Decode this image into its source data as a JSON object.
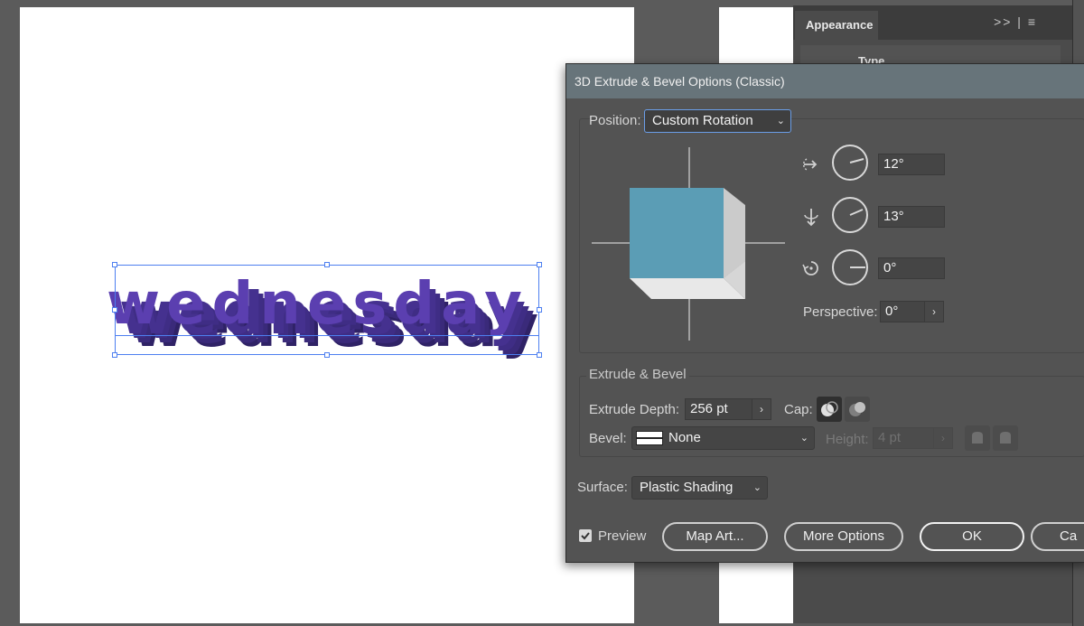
{
  "canvas": {
    "artwork_text": "wednesday",
    "text_color": "#5b3fb0",
    "extrude_color": "#3f2d85"
  },
  "appearance_panel": {
    "tab_label": "Appearance",
    "menu_icons": ">> | ≡",
    "type_row_label": "Type"
  },
  "dialog": {
    "title": "3D Extrude & Bevel Options (Classic)",
    "position": {
      "label": "Position:",
      "value": "Custom Rotation"
    },
    "rotation": {
      "x_angle": "12°",
      "y_angle": "13°",
      "z_angle": "0°"
    },
    "perspective": {
      "label": "Perspective:",
      "value": "0°"
    },
    "extrude_bevel": {
      "group_title": "Extrude & Bevel",
      "extrude_depth_label": "Extrude Depth:",
      "extrude_depth_value": "256 pt",
      "cap_label": "Cap:",
      "bevel_label": "Bevel:",
      "bevel_value": "None",
      "height_label": "Height:",
      "height_value": "4 pt"
    },
    "surface": {
      "label": "Surface:",
      "value": "Plastic Shading"
    },
    "preview_label": "Preview",
    "buttons": {
      "map_art": "Map Art...",
      "more_options": "More Options",
      "ok": "OK",
      "cancel": "Ca"
    },
    "cube_colors": {
      "front": "#5b9db5",
      "side": "#cbcbcb",
      "bottom": "#e3e3e3"
    }
  }
}
